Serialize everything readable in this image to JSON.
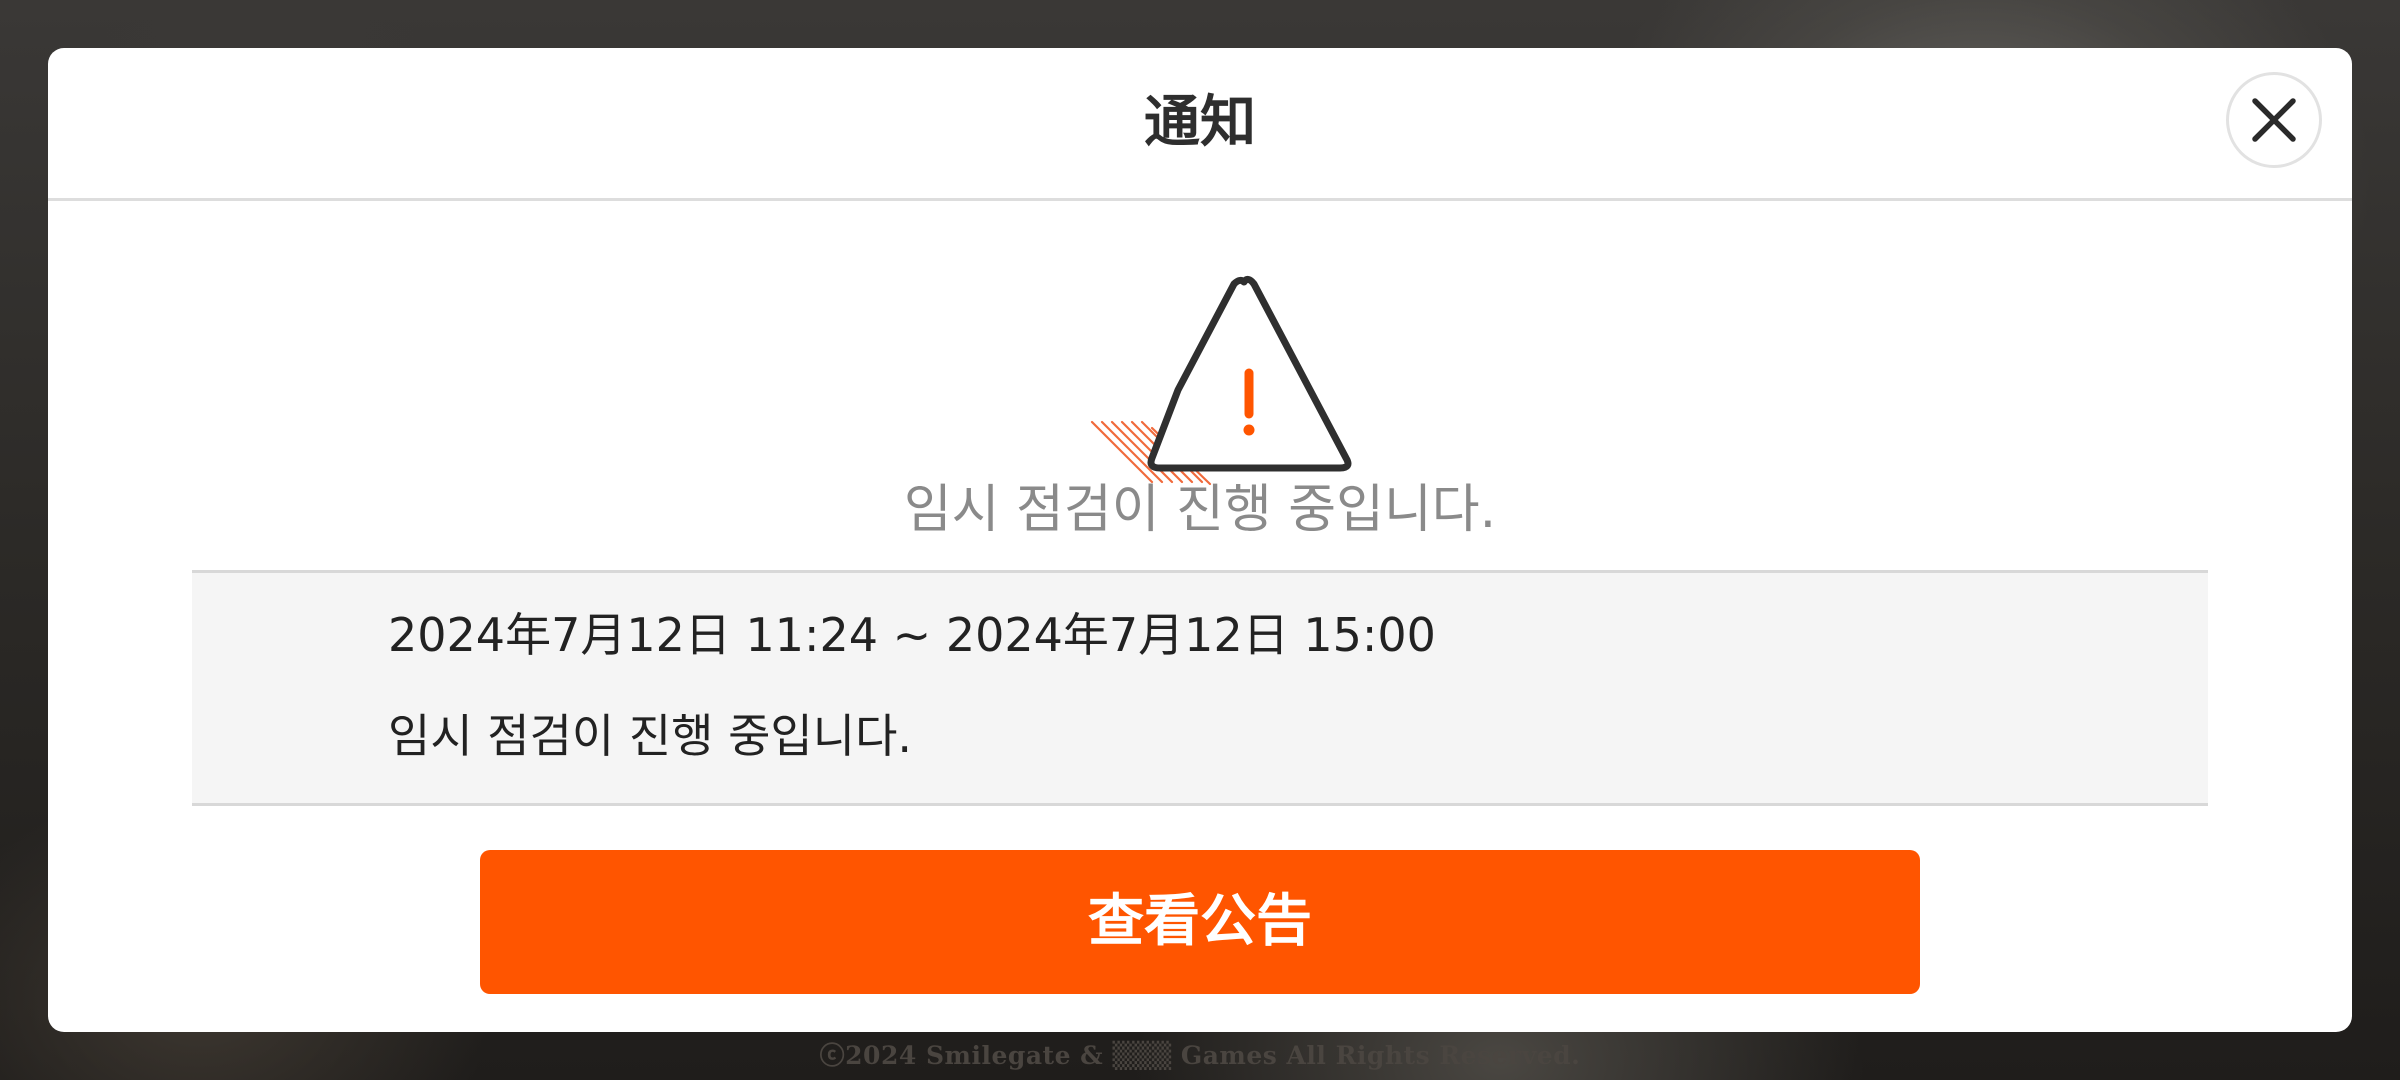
{
  "background": {
    "copyright": "ⓒ2024 Smilegate & ▒▒▒ Games All Rights Reserved."
  },
  "dialog": {
    "title": "通知",
    "close_icon": "close-icon",
    "warning_icon": "warning-triangle-icon",
    "headline": "임시 점검이 진행 중입니다.",
    "period": "2024年7月12日 11:24 ~ 2024年7月12日 15:00",
    "detail": "임시 점검이 진행 중입니다.",
    "action_label": "查看公告"
  },
  "colors": {
    "accent": "#ff5500",
    "title_text": "#2e2e2e",
    "headline_text": "#8a8a8a",
    "info_background": "#f5f5f5"
  }
}
